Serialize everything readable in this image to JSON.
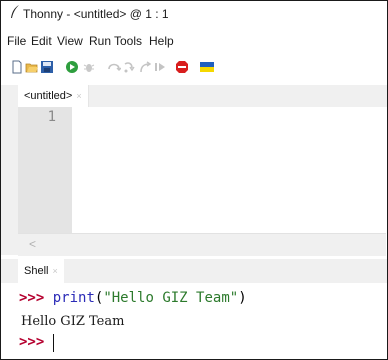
{
  "window": {
    "title": "Thonny  -  <untitled>  @  1 : 1"
  },
  "menu": [
    "File",
    "Edit",
    "View",
    "Run",
    "Tools",
    "Help"
  ],
  "toolbar": {
    "icons": [
      "new-file",
      "open-file",
      "save-file",
      "run",
      "debug",
      "step-over",
      "step-into",
      "step-out",
      "resume",
      "stop",
      "flag"
    ]
  },
  "editor": {
    "tab_label": "<untitled>",
    "tab_close": "×",
    "line_numbers": [
      "1"
    ],
    "scroll_left": "<"
  },
  "shell": {
    "tab_label": "Shell",
    "tab_close": "×",
    "prompt": ">>>",
    "command_fn": "print",
    "command_open": "(",
    "command_str": "\"Hello GIZ Team\"",
    "command_close": ")",
    "output": "Hello GIZ Team",
    "prompt2": ">>>"
  },
  "colors": {
    "prompt": "#b5002f",
    "stop": "#d81e1e",
    "run": "#2e9e3e",
    "flag_blue": "#1f5fbf",
    "flag_yellow": "#f5d800"
  }
}
